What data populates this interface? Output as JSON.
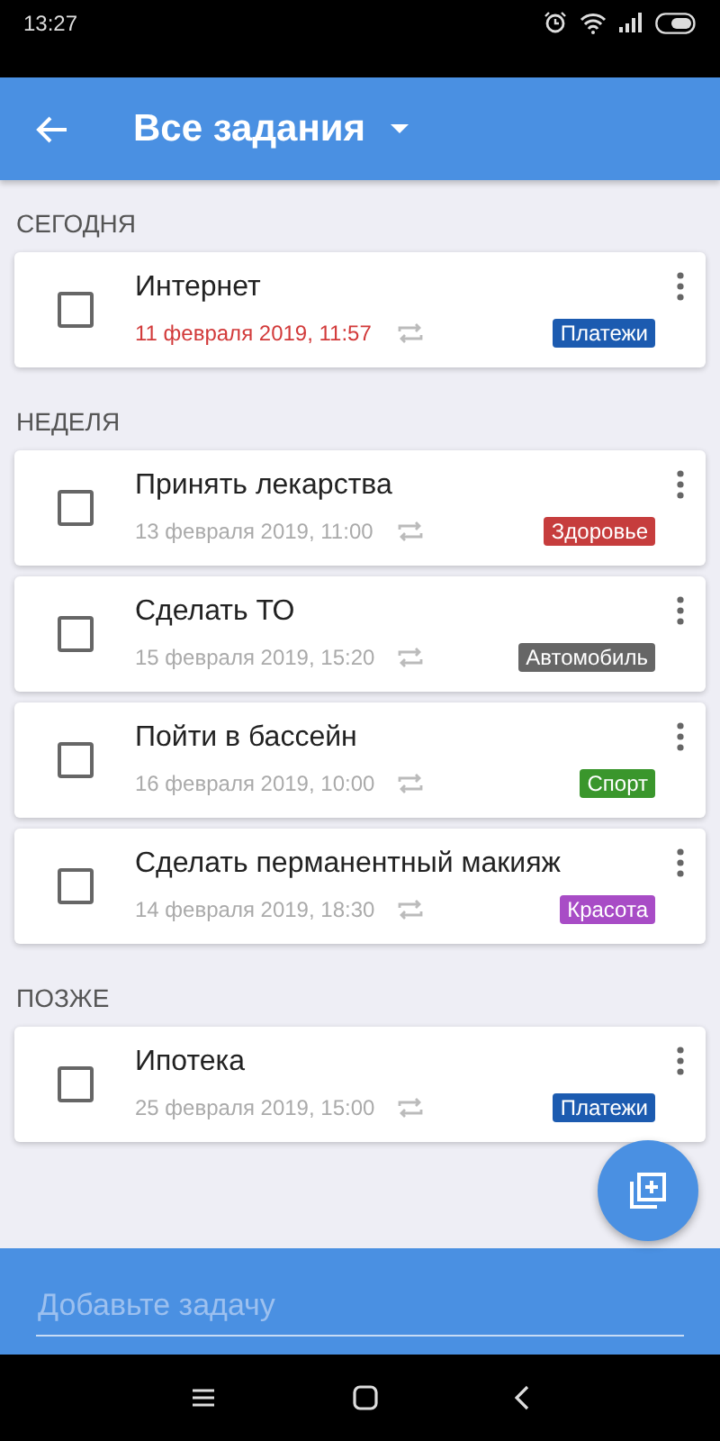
{
  "status_bar": {
    "time": "13:27"
  },
  "app_bar": {
    "title": "Все задания"
  },
  "sections": [
    {
      "heading": "СЕГОДНЯ",
      "tasks": [
        {
          "title": "Интернет",
          "date": "11 февраля 2019, 11:57",
          "overdue": true,
          "checked": false,
          "tag": "Платежи",
          "color": "#1c5bb0"
        }
      ]
    },
    {
      "heading": "НЕДЕЛЯ",
      "tasks": [
        {
          "title": "Принять лекарства",
          "date": "13 февраля 2019, 11:00",
          "overdue": false,
          "checked": false,
          "tag": "Здоровье",
          "color": "#c63d3d"
        },
        {
          "title": "Сделать ТО",
          "date": "15 февраля 2019, 15:20",
          "overdue": false,
          "checked": false,
          "tag": "Автомобиль",
          "color": "#666666"
        },
        {
          "title": "Пойти в бассейн",
          "date": "16 февраля 2019, 10:00",
          "overdue": false,
          "checked": false,
          "tag": "Спорт",
          "color": "#3a962c"
        },
        {
          "title": "Сделать перманентный макияж",
          "date": "14 февраля 2019, 18:30",
          "overdue": false,
          "checked": false,
          "tag": "Красота",
          "color": "#a84cc6"
        }
      ]
    },
    {
      "heading": "ПОЗЖЕ",
      "tasks": [
        {
          "title": "Ипотека",
          "date": "25 февраля 2019, 15:00",
          "overdue": false,
          "checked": false,
          "tag": "Платежи",
          "color": "#1c5bb0"
        }
      ]
    }
  ],
  "add_task": {
    "placeholder": "Добавьте задачу"
  }
}
